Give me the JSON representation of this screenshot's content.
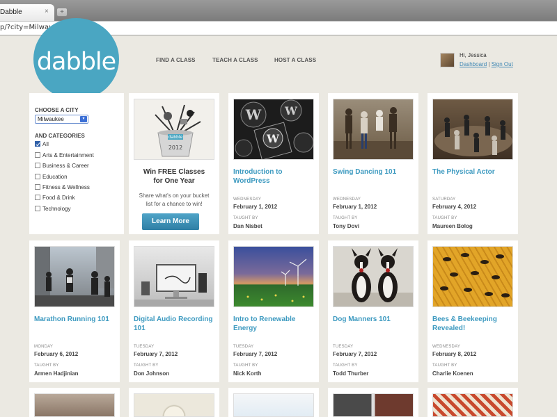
{
  "browser": {
    "tab_title": "Dabble",
    "tab_close": "×",
    "new_tab": "+",
    "url": "p/?city=Milwaukee&all=true"
  },
  "header": {
    "logo": "dabble",
    "nav": [
      "FIND A CLASS",
      "TEACH A CLASS",
      "HOST A CLASS"
    ],
    "greeting": "Hi, Jessica",
    "dashboard": "Dashboard",
    "separator": "|",
    "signout": "Sign Out"
  },
  "filters": {
    "city_label": "CHOOSE A CITY",
    "city_value": "Milwaukee",
    "categories_label": "AND CATEGORIES",
    "categories": [
      {
        "label": "All",
        "checked": true
      },
      {
        "label": "Arts & Entertainment",
        "checked": false
      },
      {
        "label": "Business & Career",
        "checked": false
      },
      {
        "label": "Education",
        "checked": false
      },
      {
        "label": "Fitness & Wellness",
        "checked": false
      },
      {
        "label": "Food & Drink",
        "checked": false
      },
      {
        "label": "Technology",
        "checked": false
      }
    ]
  },
  "promo": {
    "title_line1": "Win FREE Classes",
    "title_line2": "for One Year",
    "text": "Share what's on your bucket list for a chance to win!",
    "button": "Learn More",
    "bucket_logo": "dabble",
    "bucket_year": "2012"
  },
  "labels": {
    "taught_by": "TAUGHT BY"
  },
  "classes": [
    {
      "title": "Introduction to WordPress",
      "day": "WEDNESDAY",
      "date": "February 1, 2012",
      "teacher": "Dan Nisbet"
    },
    {
      "title": "Swing Dancing 101",
      "day": "WEDNESDAY",
      "date": "February 1, 2012",
      "teacher": "Tony Dovi"
    },
    {
      "title": "The Physical Actor",
      "day": "SATURDAY",
      "date": "February 4, 2012",
      "teacher": "Maureen Bolog"
    },
    {
      "title": "Marathon Running 101",
      "day": "MONDAY",
      "date": "February 6, 2012",
      "teacher": "Armen Hadjinian"
    },
    {
      "title": "Digital Audio Recording 101",
      "day": "TUESDAY",
      "date": "February 7, 2012",
      "teacher": "Don Johnson"
    },
    {
      "title": "Intro to Renewable Energy",
      "day": "TUESDAY",
      "date": "February 7, 2012",
      "teacher": "Nick Korth"
    },
    {
      "title": "Dog Manners 101",
      "day": "TUESDAY",
      "date": "February 7, 2012",
      "teacher": "Todd Thurber"
    },
    {
      "title": "Bees & Beekeeping Revealed!",
      "day": "WEDNESDAY",
      "date": "February 8, 2012",
      "teacher": "Charlie Koenen"
    }
  ],
  "colors": {
    "accent": "#3d9ac0",
    "logo": "#4aa6c2",
    "background": "#ebe9e2"
  }
}
